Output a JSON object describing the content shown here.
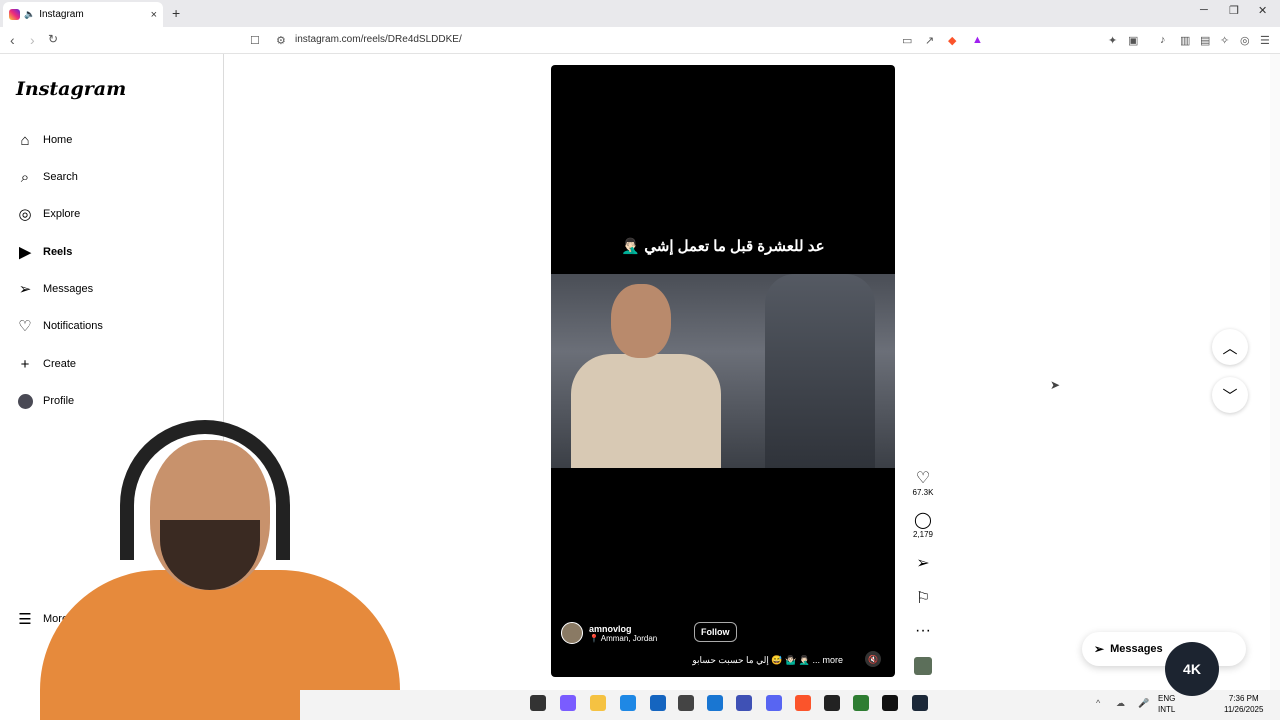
{
  "browser": {
    "tab_title": "Instagram",
    "tab_close": "×",
    "new_tab": "+",
    "url": "instagram.com/reels/DRe4dSLDDKE/"
  },
  "sidebar": {
    "logo": "Instagram",
    "items": [
      {
        "label": "Home",
        "icon": "home-icon"
      },
      {
        "label": "Search",
        "icon": "search-icon"
      },
      {
        "label": "Explore",
        "icon": "explore-icon"
      },
      {
        "label": "Reels",
        "icon": "reels-icon"
      },
      {
        "label": "Messages",
        "icon": "messages-icon"
      },
      {
        "label": "Notifications",
        "icon": "heart-icon"
      },
      {
        "label": "Create",
        "icon": "plus-icon"
      },
      {
        "label": "Profile",
        "icon": "avatar"
      }
    ],
    "more": "More"
  },
  "reel": {
    "overlay_text": "عد للعشرة قبل ما تعمل إشي 🤦🏻‍♂️",
    "author": "amnovlog",
    "location": "Amman, Jordan",
    "follow": "Follow",
    "description": "إلي ما حسبت حسابو 😅 🤷🏻‍♂️ 🤦🏻‍♂️ ... more"
  },
  "actions": {
    "likes": "67.3K",
    "comments": "2,179"
  },
  "messages_button": "Messages",
  "taskbar": {
    "lang1": "ENG",
    "lang2": "INTL",
    "time": "7:36 PM",
    "date": "11/26/2025",
    "badge": "4K"
  }
}
